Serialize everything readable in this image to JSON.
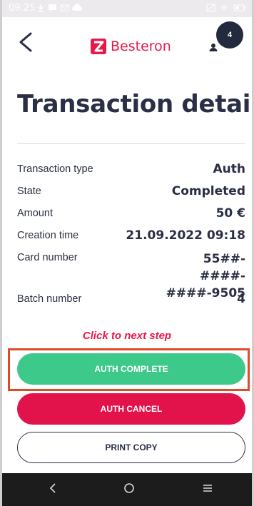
{
  "status_bar": {
    "time": "09:25"
  },
  "header": {
    "brand_name": "Besteron",
    "brand_color": "#e8194a",
    "avatar_count": "4"
  },
  "page_title": "Transaction detail",
  "details": [
    {
      "label": "Transaction type",
      "value": "Auth"
    },
    {
      "label": "State",
      "value": "Completed"
    },
    {
      "label": "Amount",
      "value": "50 €"
    },
    {
      "label": "Creation time",
      "value": "21.09.2022 09:18"
    },
    {
      "label": "Card number",
      "value": "55##-####-####-9505"
    },
    {
      "label": "Batch number",
      "value": "4"
    }
  ],
  "hint": "Click to next step",
  "buttons": {
    "auth_complete": "AUTH COMPLETE",
    "auth_cancel": "AUTH CANCEL",
    "print_copy": "PRINT COPY"
  },
  "colors": {
    "complete": "#3cc98a",
    "cancel": "#e2124a",
    "highlight": "#e04a26",
    "text": "#2a2f45"
  },
  "icons": {
    "back": "chevron-left-icon",
    "avatar": "user-icon",
    "nav_back": "nav-back-icon",
    "nav_home": "nav-home-icon",
    "nav_recents": "nav-recents-icon"
  }
}
